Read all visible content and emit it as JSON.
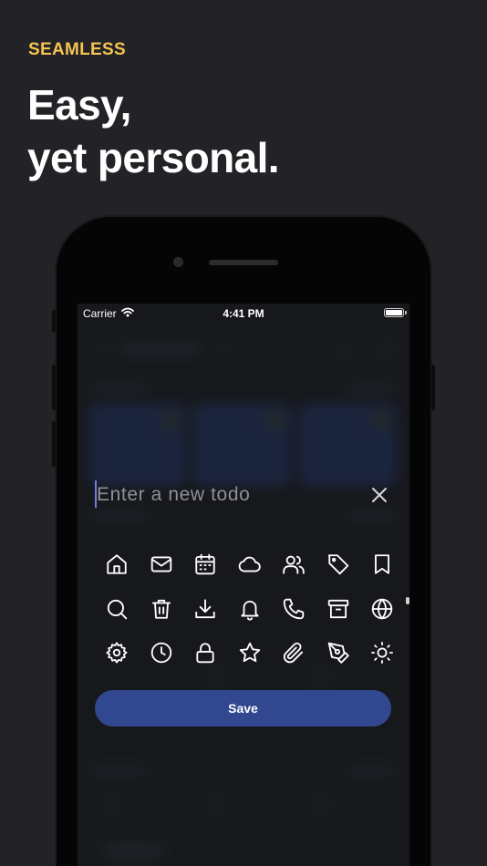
{
  "promo": {
    "eyebrow": "SEAMLESS",
    "headline_line1": "Easy,",
    "headline_line2": "yet personal."
  },
  "status_bar": {
    "carrier": "Carrier",
    "time": "4:41 PM"
  },
  "sheet": {
    "input_placeholder": "Enter a new todo",
    "input_value": "",
    "save_label": "Save",
    "icons": [
      [
        "home-icon",
        "mail-icon",
        "calendar-icon",
        "cloud-icon",
        "users-icon",
        "tag-icon",
        "bookmark-icon"
      ],
      [
        "search-icon",
        "trash-icon",
        "download-icon",
        "bell-icon",
        "phone-icon",
        "archive-icon",
        "globe-icon"
      ],
      [
        "settings-icon",
        "clock-icon",
        "lock-icon",
        "star-icon",
        "paperclip-icon",
        "pen-tool-icon",
        "sun-icon"
      ]
    ]
  },
  "colors": {
    "background": "#232226",
    "accent": "#f5c451",
    "save_button": "#31478f",
    "caret": "#6d7ee0"
  }
}
